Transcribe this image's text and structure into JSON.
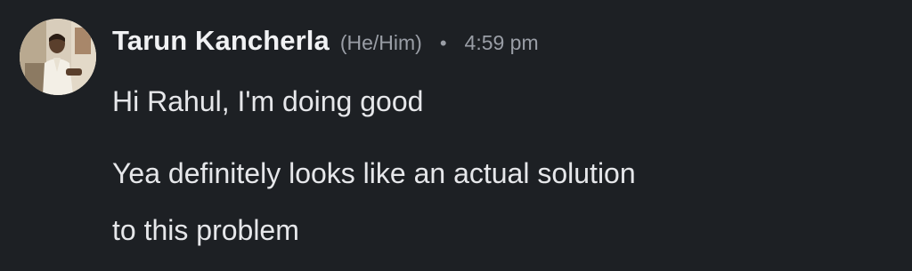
{
  "message": {
    "sender_name": "Tarun Kancherla",
    "pronouns": "(He/Him)",
    "separator": "•",
    "timestamp": "4:59 pm",
    "avatar_icon": "user-avatar-photo",
    "paragraphs": [
      "Hi Rahul, I'm doing good",
      "Yea definitely looks like an actual solution",
      "to this problem"
    ]
  },
  "colors": {
    "background": "#1d2024",
    "name_text": "#f1f2f4",
    "meta_text": "#9a9ea6",
    "body_text": "#e6e7ea"
  }
}
